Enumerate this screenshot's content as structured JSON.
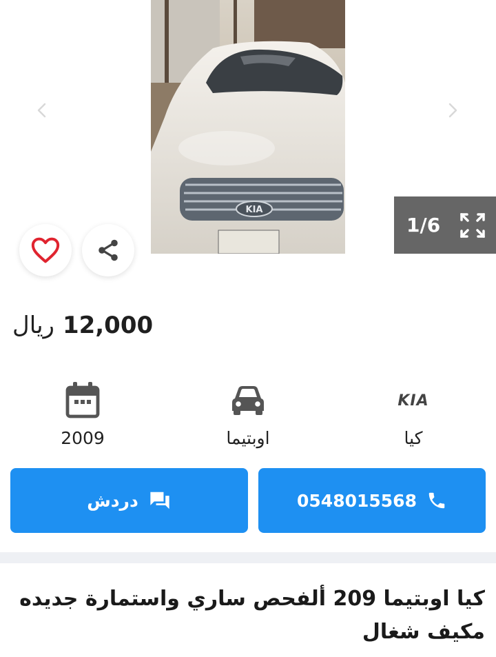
{
  "gallery": {
    "counter": "1/6",
    "prev_icon": "chevron-left-icon",
    "next_icon": "chevron-right-icon",
    "expand_icon": "fullscreen-icon"
  },
  "listing": {
    "price": "12,000",
    "currency": "ريال",
    "year": "2009",
    "model": "اوبتيما",
    "make": "كيا",
    "make_logo_text": "KIA",
    "description": "كيا اوبتيما 209 ألفحص ساري واستمارة جديده مكيف شغال"
  },
  "actions": {
    "chat_label": "دردش",
    "phone": "0548015568",
    "favorite_icon": "heart-icon",
    "share_icon": "share-icon"
  },
  "colors": {
    "primary": "#1e90f2",
    "favorite": "#e0242f",
    "counter_bg": "#666666",
    "separator": "#eef0f4"
  }
}
